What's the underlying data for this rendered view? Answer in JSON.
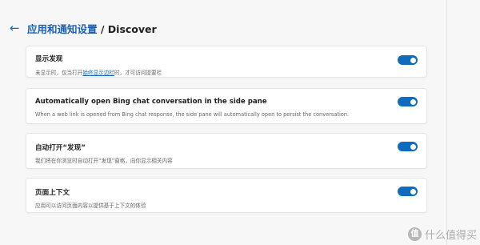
{
  "header": {
    "back_icon": "arrow-left-icon",
    "title_zh": "应用和通知设置",
    "title_sep": " / ",
    "title_en": "Discover"
  },
  "cards": [
    {
      "title": "显示发现",
      "desc_before": "未显示时，仅当打开",
      "desc_link": "始终显示边栏",
      "desc_after": "时，才可访问提要栏",
      "toggle_on": true
    },
    {
      "title": "Automatically open Bing chat conversation in the side pane",
      "desc": "When a web link is opened from Bing chat response, the side pane will automatically open to persist the conversation.",
      "toggle_on": true
    },
    {
      "title": "自动打开“发现”",
      "desc": "我们将在你浏览时自动打开“发现”窗格，向你显示相关内容",
      "toggle_on": true
    },
    {
      "title": "页面上下文",
      "desc": "应用可以访问页面内容以提供基于上下文的体验",
      "toggle_on": true
    }
  ],
  "watermark": {
    "badge": "值",
    "text": "什么值得买"
  },
  "colors": {
    "accent": "#0f6cbd",
    "background": "#f7f7f7",
    "card": "#ffffff"
  }
}
